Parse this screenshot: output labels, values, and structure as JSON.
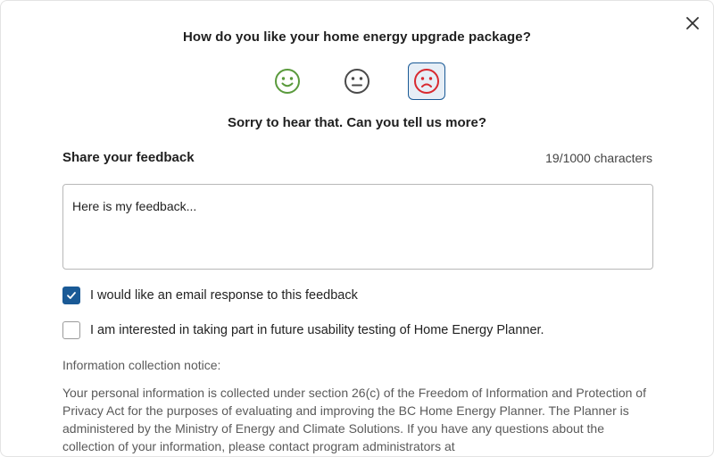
{
  "dialog": {
    "question": "How do you like your home energy upgrade package?",
    "faces": [
      {
        "icon": "happy-face-icon",
        "color": "#5a9a3c",
        "selected": false
      },
      {
        "icon": "neutral-face-icon",
        "color": "#4a4a4a",
        "selected": false
      },
      {
        "icon": "sad-face-icon",
        "color": "#d8292f",
        "selected": true
      }
    ],
    "followup": "Sorry to hear that. Can you tell us more?",
    "close_icon": "close-icon"
  },
  "feedback": {
    "label": "Share your feedback",
    "char_count": "19/1000 characters",
    "value": "Here is my feedback..."
  },
  "options": [
    {
      "label": "I would like an email response to this feedback",
      "checked": true
    },
    {
      "label": "I am interested in taking part in future usability testing of Home Energy Planner.",
      "checked": false
    }
  ],
  "notice": {
    "title": "Information collection notice:",
    "body": "Your personal information is collected under section 26(c) of the Freedom of Information and Protection of Privacy Act for the purposes of evaluating and improving the BC Home Energy Planner. The Planner is administered by the Ministry of Energy and Climate Solutions. If you have any questions about the collection of your information, please contact program administrators at"
  },
  "colors": {
    "primary": "#1a5a96",
    "selected_bg": "#e6eef6"
  }
}
